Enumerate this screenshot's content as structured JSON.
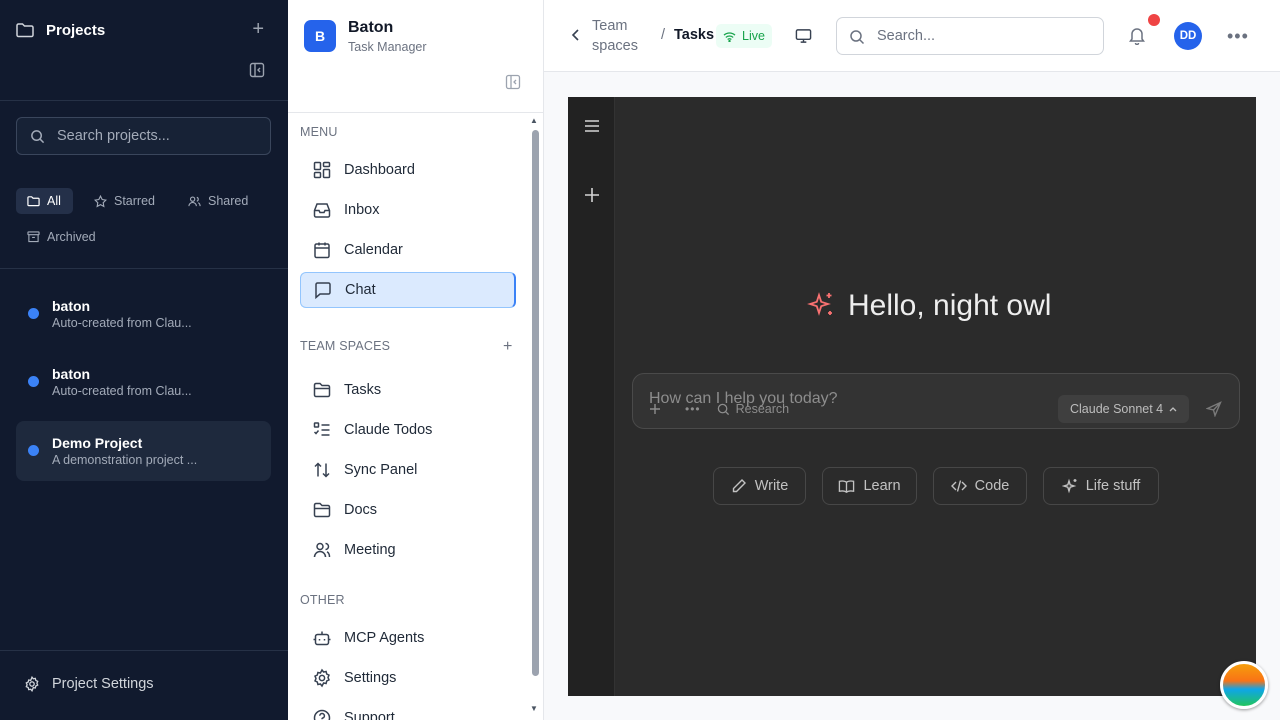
{
  "projects_panel": {
    "title": "Projects",
    "search_placeholder": "Search projects...",
    "filters": [
      "All",
      "Starred",
      "Shared",
      "Archived"
    ],
    "items": [
      {
        "name": "baton",
        "desc": "Auto-created from Clau..."
      },
      {
        "name": "baton",
        "desc": "Auto-created from Clau..."
      },
      {
        "name": "Demo Project",
        "desc": "A demonstration project ..."
      }
    ],
    "settings_label": "Project Settings",
    "dot_color": "#3b82f6"
  },
  "app": {
    "logo_letter": "B",
    "name": "Baton",
    "subtitle": "Task Manager"
  },
  "sidebar": {
    "menu_label": "MENU",
    "menu": [
      "Dashboard",
      "Inbox",
      "Calendar",
      "Chat"
    ],
    "team_label": "TEAM SPACES",
    "team": [
      "Tasks",
      "Claude Todos",
      "Sync Panel",
      "Docs",
      "Meeting"
    ],
    "other_label": "OTHER",
    "other": [
      "MCP Agents",
      "Settings",
      "Support"
    ]
  },
  "header": {
    "crumb1": "Team spaces",
    "crumb_sep": "/",
    "crumb2": "Tasks",
    "live": "Live",
    "search_placeholder": "Search...",
    "avatar": "DD"
  },
  "chat": {
    "greeting": "Hello, night owl",
    "placeholder": "How can I help you today?",
    "research": "Research",
    "model": "Claude Sonnet 4",
    "chips": [
      "Write",
      "Learn",
      "Code",
      "Life stuff"
    ]
  },
  "colors": {
    "accent": "#2563eb",
    "live": "#16a34a",
    "notification": "#ef4444",
    "sparkle": "#f87171"
  }
}
